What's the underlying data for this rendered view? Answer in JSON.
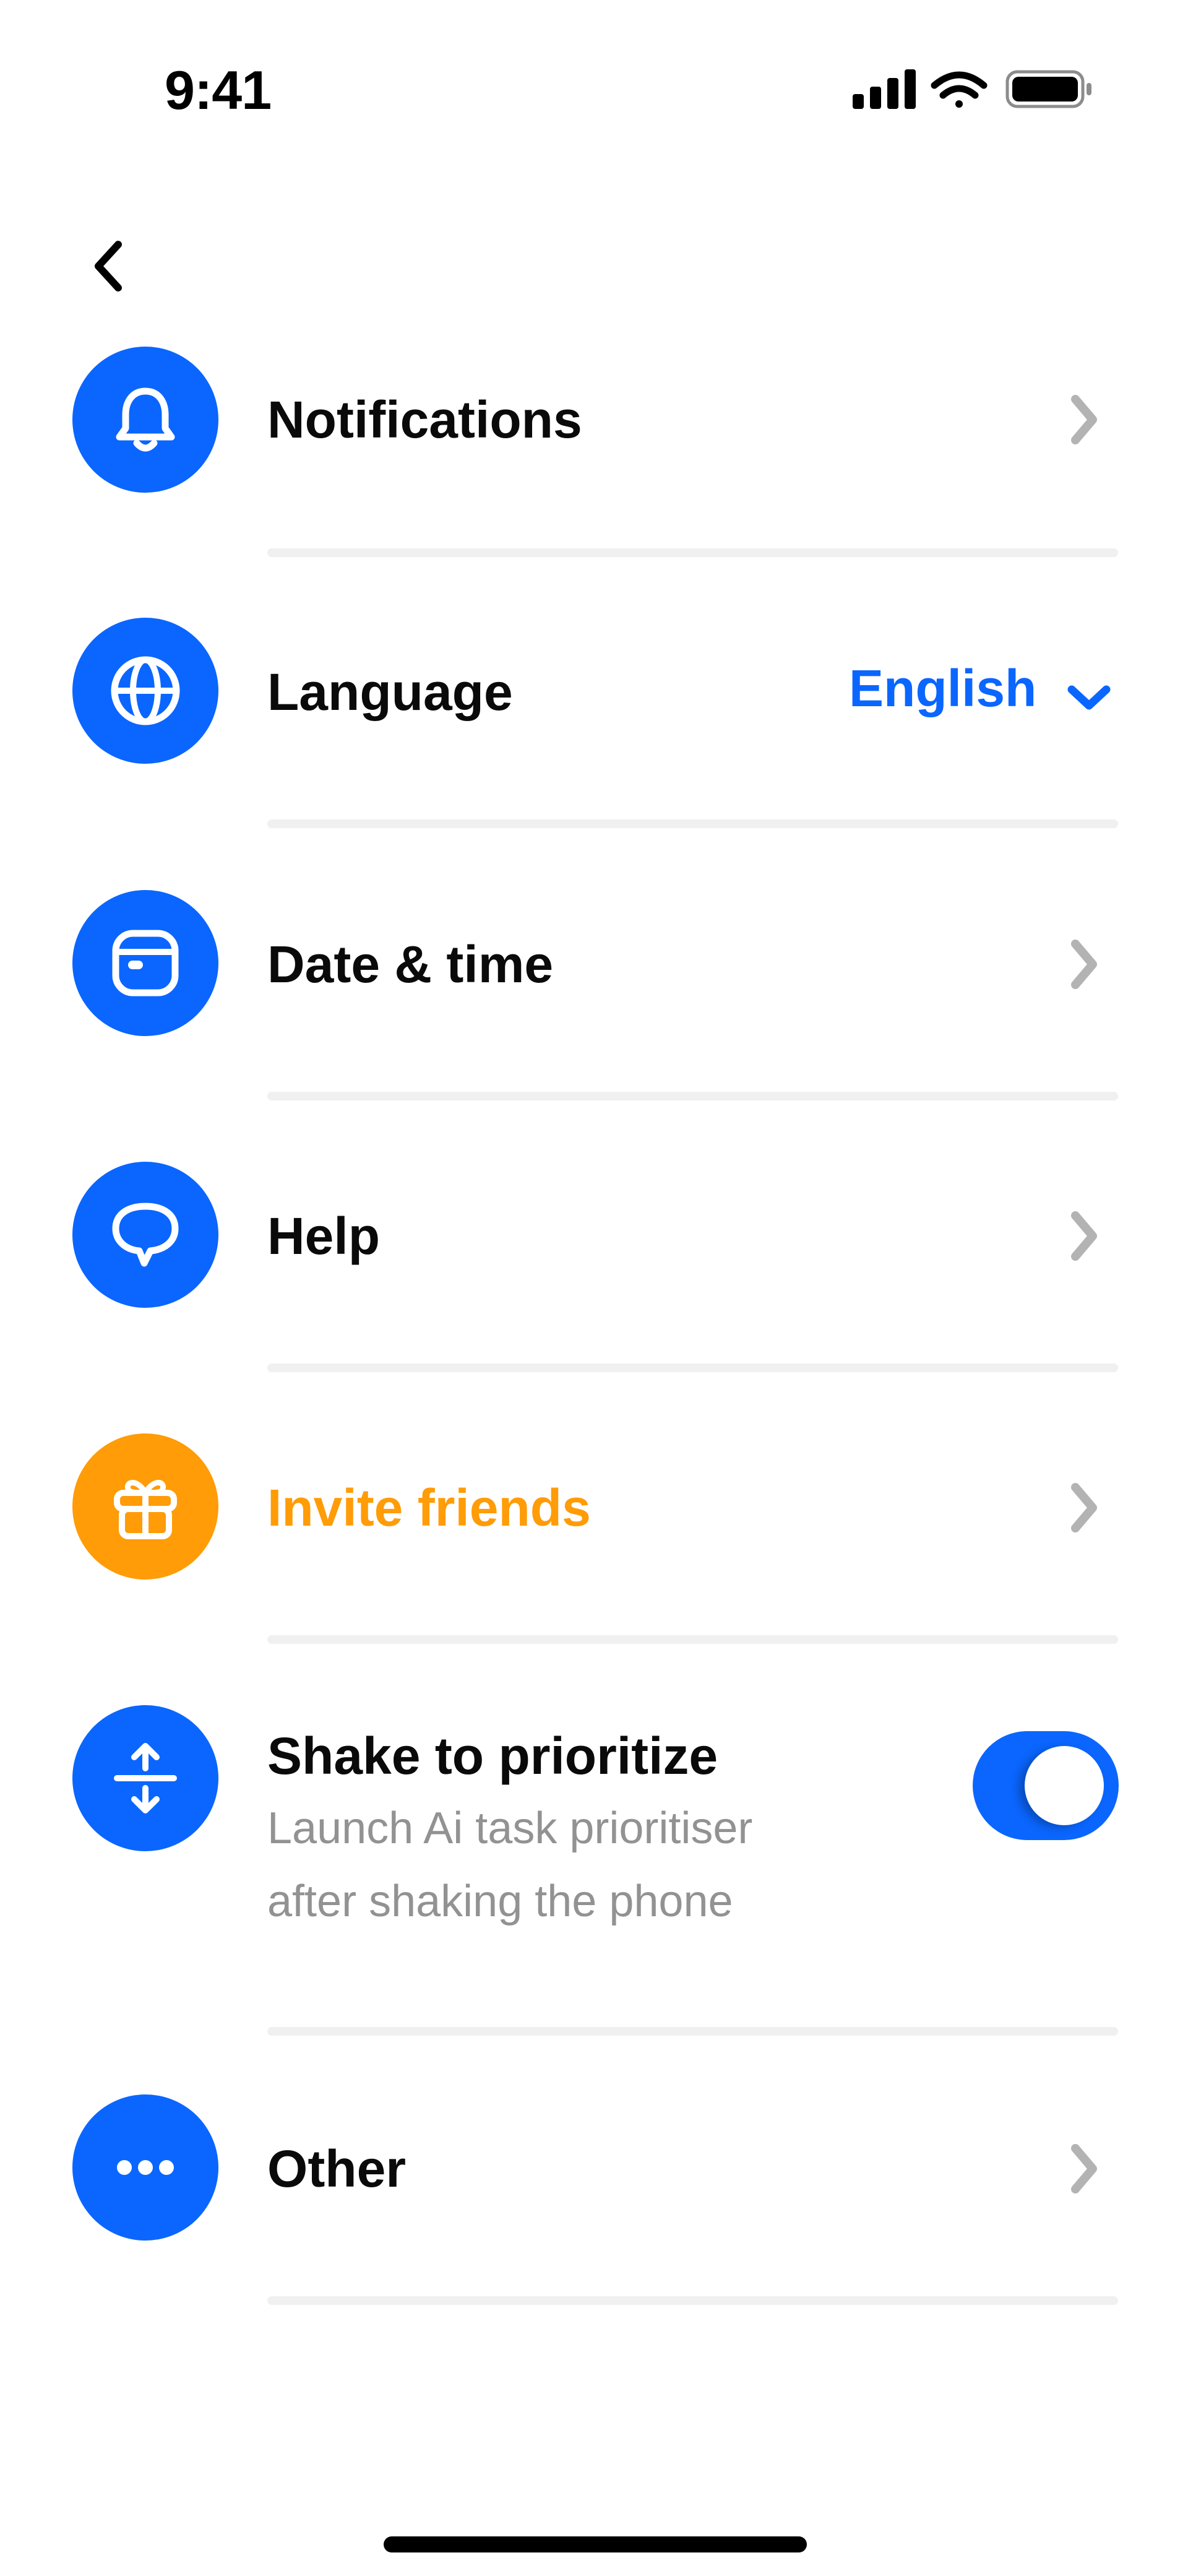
{
  "status_bar": {
    "time": "9:41"
  },
  "icons": {
    "back": "chevron-left-icon",
    "notifications": "bell-icon",
    "language": "globe-icon",
    "date_time": "calendar-icon",
    "help": "speech-bubble-icon",
    "invite": "gift-icon",
    "shake": "shake-arrows-icon",
    "other": "more-dots-icon"
  },
  "colors": {
    "accent": "#0a66ff",
    "highlight": "#ff9c07",
    "divider": "#f0f0f0",
    "subtitle": "#929292",
    "chevron": "#b3b3b3"
  },
  "settings": {
    "notifications": {
      "label": "Notifications"
    },
    "language": {
      "label": "Language",
      "value": "English"
    },
    "date_time": {
      "label": "Date & time"
    },
    "help": {
      "label": "Help"
    },
    "invite": {
      "label": "Invite friends"
    },
    "shake": {
      "label": "Shake to prioritize",
      "description_line1": "Launch Ai task prioritiser",
      "description_line2": "after shaking the phone",
      "enabled": true
    },
    "other": {
      "label": "Other"
    }
  }
}
